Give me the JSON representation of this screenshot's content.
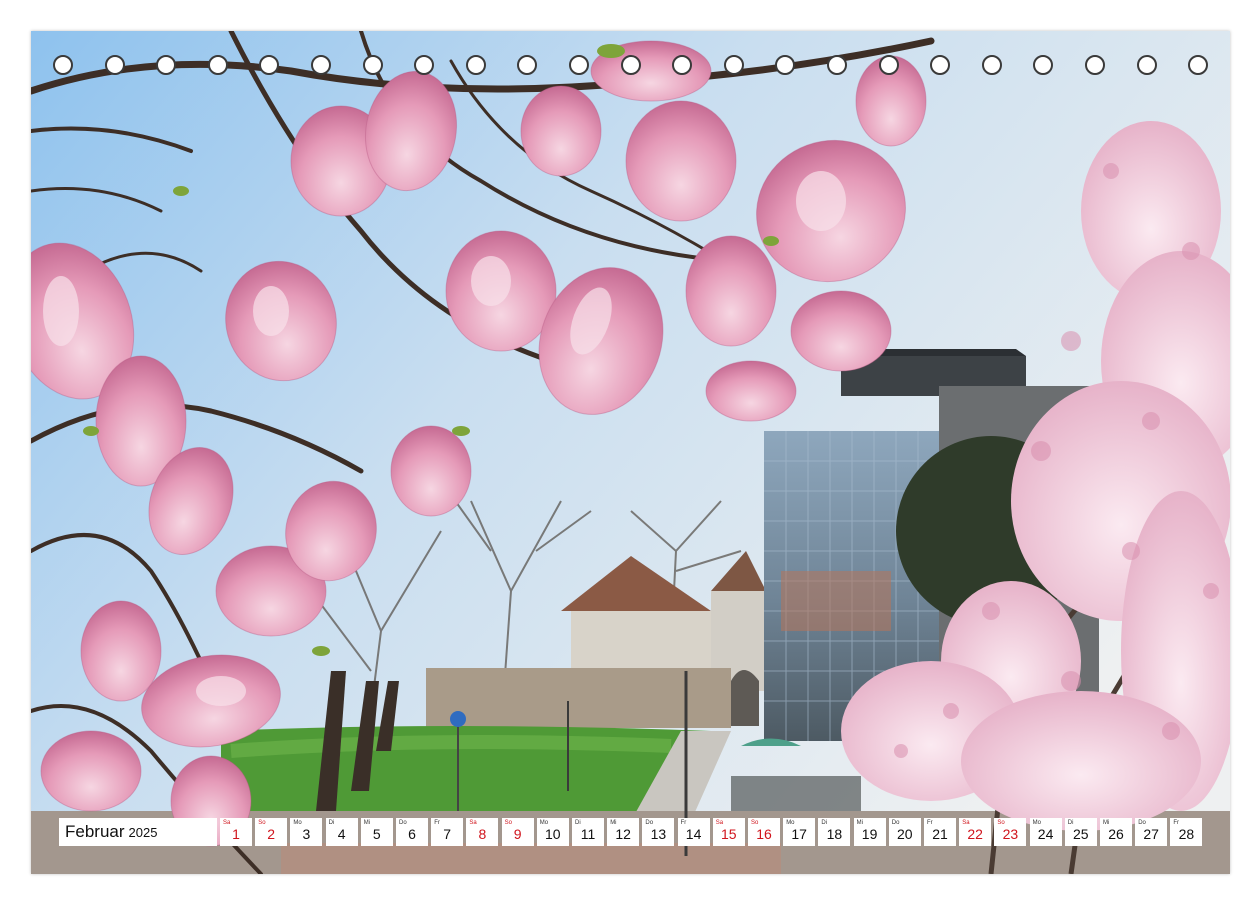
{
  "calendar": {
    "month": "Februar",
    "year": "2025",
    "days": [
      {
        "wd": "Sa",
        "num": "1",
        "weekend": true
      },
      {
        "wd": "So",
        "num": "2",
        "weekend": true
      },
      {
        "wd": "Mo",
        "num": "3",
        "weekend": false
      },
      {
        "wd": "Di",
        "num": "4",
        "weekend": false
      },
      {
        "wd": "Mi",
        "num": "5",
        "weekend": false
      },
      {
        "wd": "Do",
        "num": "6",
        "weekend": false
      },
      {
        "wd": "Fr",
        "num": "7",
        "weekend": false
      },
      {
        "wd": "Sa",
        "num": "8",
        "weekend": true
      },
      {
        "wd": "So",
        "num": "9",
        "weekend": true
      },
      {
        "wd": "Mo",
        "num": "10",
        "weekend": false
      },
      {
        "wd": "Di",
        "num": "11",
        "weekend": false
      },
      {
        "wd": "Mi",
        "num": "12",
        "weekend": false
      },
      {
        "wd": "Do",
        "num": "13",
        "weekend": false
      },
      {
        "wd": "Fr",
        "num": "14",
        "weekend": false
      },
      {
        "wd": "Sa",
        "num": "15",
        "weekend": true
      },
      {
        "wd": "So",
        "num": "16",
        "weekend": true
      },
      {
        "wd": "Mo",
        "num": "17",
        "weekend": false
      },
      {
        "wd": "Di",
        "num": "18",
        "weekend": false
      },
      {
        "wd": "Mi",
        "num": "19",
        "weekend": false
      },
      {
        "wd": "Do",
        "num": "20",
        "weekend": false
      },
      {
        "wd": "Fr",
        "num": "21",
        "weekend": false
      },
      {
        "wd": "Sa",
        "num": "22",
        "weekend": true
      },
      {
        "wd": "So",
        "num": "23",
        "weekend": true
      },
      {
        "wd": "Mo",
        "num": "24",
        "weekend": false
      },
      {
        "wd": "Di",
        "num": "25",
        "weekend": false
      },
      {
        "wd": "Mi",
        "num": "26",
        "weekend": false
      },
      {
        "wd": "Do",
        "num": "27",
        "weekend": false
      },
      {
        "wd": "Fr",
        "num": "28",
        "weekend": false
      }
    ]
  },
  "binding": {
    "hole_count": 23
  },
  "colors": {
    "weekend": "#d0141c",
    "sky": "#9cc8ec",
    "blossom": "#e79ab8",
    "lawn": "#4f9a36"
  }
}
